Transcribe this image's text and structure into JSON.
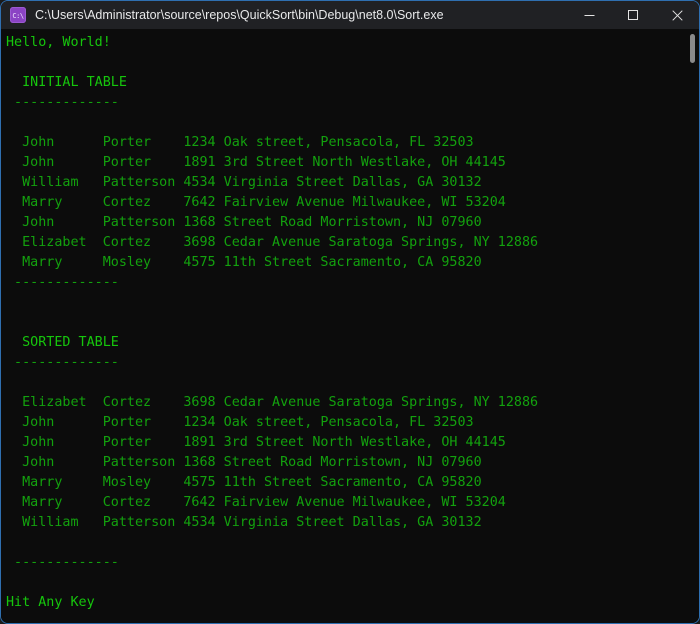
{
  "window": {
    "title": "C:\\Users\\Administrator\\source\\repos\\QuickSort\\bin\\Debug\\net8.0\\Sort.exe",
    "icon_glyph": "C:\\",
    "accent_border_color": "#2f6fb0",
    "titlebar_bg": "#202124",
    "controls": {
      "minimize_label": "Minimize",
      "maximize_label": "Maximize",
      "close_label": "Close"
    }
  },
  "console": {
    "background_color": "#0c0c0c",
    "bright_text_color": "#16c60c",
    "text_color": "#13a10e",
    "greeting": "Hello, World!",
    "initial_heading": "  INITIAL TABLE",
    "initial_rule": " -------------",
    "sorted_heading": "  SORTED TABLE",
    "sorted_rule": " -------------",
    "closing_rule": " -------------",
    "prompt": "Hit Any Key",
    "initial_rows": [
      "  John      Porter    1234 Oak street, Pensacola, FL 32503",
      "  John      Porter    1891 3rd Street North Westlake, OH 44145",
      "  William   Patterson 4534 Virginia Street Dallas, GA 30132",
      "  Marry     Cortez    7642 Fairview Avenue Milwaukee, WI 53204",
      "  John      Patterson 1368 Street Road Morristown, NJ 07960",
      "  Elizabet  Cortez    3698 Cedar Avenue Saratoga Springs, NY 12886",
      "  Marry     Mosley    4575 11th Street Sacramento, CA 95820"
    ],
    "sorted_rows": [
      "  Elizabet  Cortez    3698 Cedar Avenue Saratoga Springs, NY 12886",
      "  John      Porter    1234 Oak street, Pensacola, FL 32503",
      "  John      Porter    1891 3rd Street North Westlake, OH 44145",
      "  John      Patterson 1368 Street Road Morristown, NJ 07960",
      "  Marry     Mosley    4575 11th Street Sacramento, CA 95820",
      "  Marry     Cortez    7642 Fairview Avenue Milwaukee, WI 53204",
      "  William   Patterson 4534 Virginia Street Dallas, GA 30132"
    ]
  },
  "scrollbar": {
    "thumb_color": "#8a8a8a"
  }
}
